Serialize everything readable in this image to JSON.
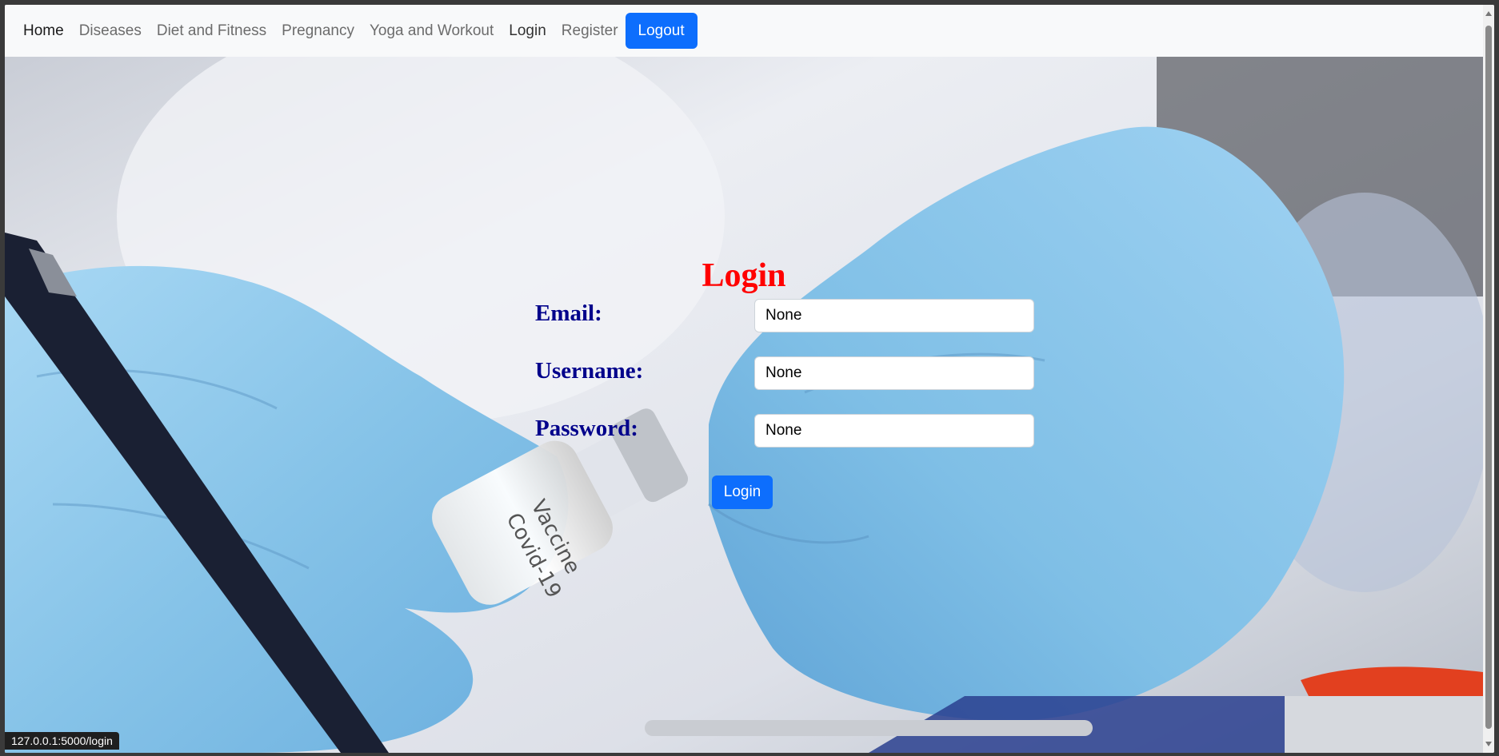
{
  "nav": {
    "links": [
      "Home",
      "Diseases",
      "Diet and Fitness",
      "Pregnancy",
      "Yoga and Workout",
      "Login",
      "Register"
    ],
    "logout_label": "Logout"
  },
  "form": {
    "title": "Login",
    "email_label": "Email:",
    "email_value": "None",
    "username_label": "Username:",
    "username_value": "None",
    "password_label": "Password:",
    "password_value": "None",
    "submit_label": "Login"
  },
  "hero_image": {
    "vial_text_line1": "Vaccine",
    "vial_text_line2": "Covid-19"
  },
  "status_bar": {
    "url": "127.0.0.1:5000/login"
  },
  "colors": {
    "title": "#ff0000",
    "labels": "#00008b",
    "primary": "#0d6efd",
    "glove": "#8ec8ea"
  }
}
